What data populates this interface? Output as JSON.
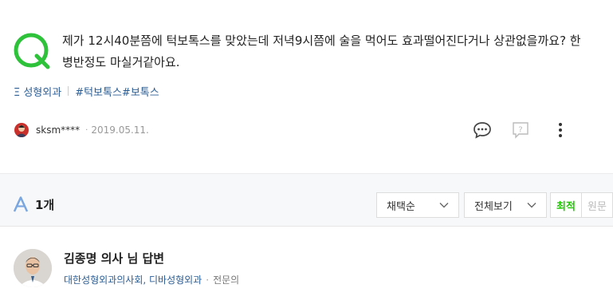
{
  "question": {
    "text": "제가 12시40분쯤에 턱보톡스를 맞았는데 저녁9시쯤에 술을 먹어도 효과떨어진다거나 상관없을까요? 한병반정도 마실거같아요.",
    "tags": [
      "Ξ 성형외과",
      "#턱보톡스",
      "#보톡스"
    ],
    "author": "sksm****",
    "date": "2019.05.11."
  },
  "answers_header": {
    "count_label": "1개",
    "sort_selected": "채택순",
    "view_selected": "전체보기",
    "toggle_active": "최적",
    "toggle_inactive": "원문"
  },
  "answerer": {
    "title": "김종명 의사 님 답변",
    "affiliation": "대한성형외과의사회, 디바성형외과",
    "role": "전문의"
  },
  "colors": {
    "brand_green": "#1ec800",
    "q_mark": "#2ec23b",
    "a_mark": "#7aa7e0",
    "link_blue": "#2b5d95"
  },
  "icons": [
    "question-mark-icon",
    "answer-mark-icon",
    "comment-icon",
    "report-icon",
    "more-icon",
    "chevron-down-icon"
  ]
}
